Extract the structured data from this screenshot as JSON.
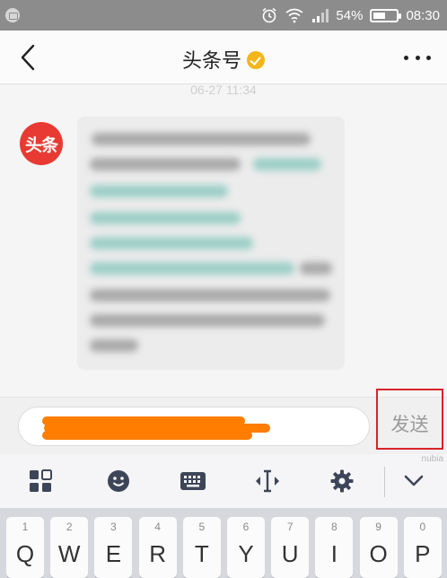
{
  "status_bar": {
    "battery_percent": "54%",
    "battery_level": 0.54,
    "time": "08:30",
    "icons": [
      "notification-icon",
      "alarm-icon",
      "wifi-icon",
      "signal-icon",
      "battery-icon"
    ]
  },
  "header": {
    "title": "头条号",
    "back_icon": "chevron-left-icon",
    "verified_icon": "verified-badge-icon",
    "more_icon": "more-dots-icon"
  },
  "chat": {
    "timestamp": "06-27 11:34",
    "sender_avatar_text": "头条"
  },
  "input_bar": {
    "send_label": "发送",
    "highlight_color": "#d9232b",
    "redaction_color": "#ff7d00"
  },
  "keyboard_toolbar": {
    "tools": [
      "layout-grid-icon",
      "emoji-icon",
      "keyboard-icon",
      "text-cursor-icon",
      "settings-gear-icon",
      "collapse-chevron-icon"
    ],
    "brand": "nubia"
  },
  "keyboard": {
    "keys": [
      {
        "num": "1",
        "letter": "Q"
      },
      {
        "num": "2",
        "letter": "W"
      },
      {
        "num": "3",
        "letter": "E"
      },
      {
        "num": "4",
        "letter": "R"
      },
      {
        "num": "5",
        "letter": "T"
      },
      {
        "num": "6",
        "letter": "Y"
      },
      {
        "num": "7",
        "letter": "U"
      },
      {
        "num": "8",
        "letter": "I"
      },
      {
        "num": "9",
        "letter": "O"
      },
      {
        "num": "0",
        "letter": "P"
      }
    ]
  }
}
